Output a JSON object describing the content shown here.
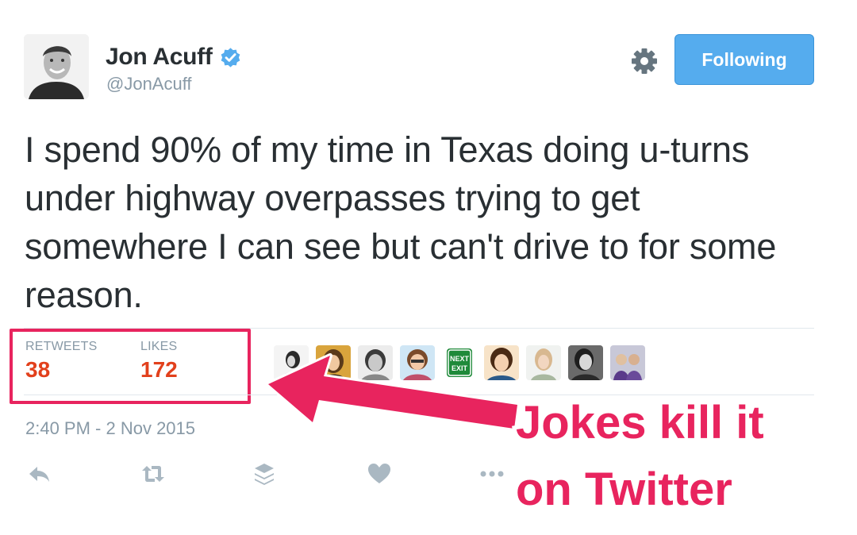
{
  "author": {
    "display_name": "Jon Acuff",
    "handle": "@JonAcuff",
    "verified": true,
    "avatar_icon": "avatar-photo"
  },
  "header": {
    "follow_button_label": "Following",
    "settings_icon": "gear-icon"
  },
  "tweet": {
    "text": "I spend 90% of my time in Texas doing u-turns under highway overpasses trying to get somewhere I can see but can't drive to for some reason.",
    "timestamp": "2:40 PM - 2 Nov 2015"
  },
  "stats": {
    "retweets_label": "RETWEETS",
    "retweets_value": "38",
    "likes_label": "LIKES",
    "likes_value": "172"
  },
  "liker_avatars": [
    "liker-1",
    "liker-2",
    "liker-3",
    "liker-4",
    "liker-5-next-exit",
    "liker-6",
    "liker-7",
    "liker-8",
    "liker-9"
  ],
  "liker_avatar_text": {
    "next_exit_line1": "NEXT",
    "next_exit_line2": "EXIT"
  },
  "actions": [
    "reply-icon",
    "retweet-icon",
    "buffer-icon",
    "like-icon",
    "more-icon"
  ],
  "annotation": {
    "line1": "Jokes kill it",
    "line2": "on Twitter",
    "color": "#e8245e"
  },
  "colors": {
    "brand_blue": "#55acee",
    "like_red": "#e0245e",
    "muted_text": "#8899a6"
  }
}
